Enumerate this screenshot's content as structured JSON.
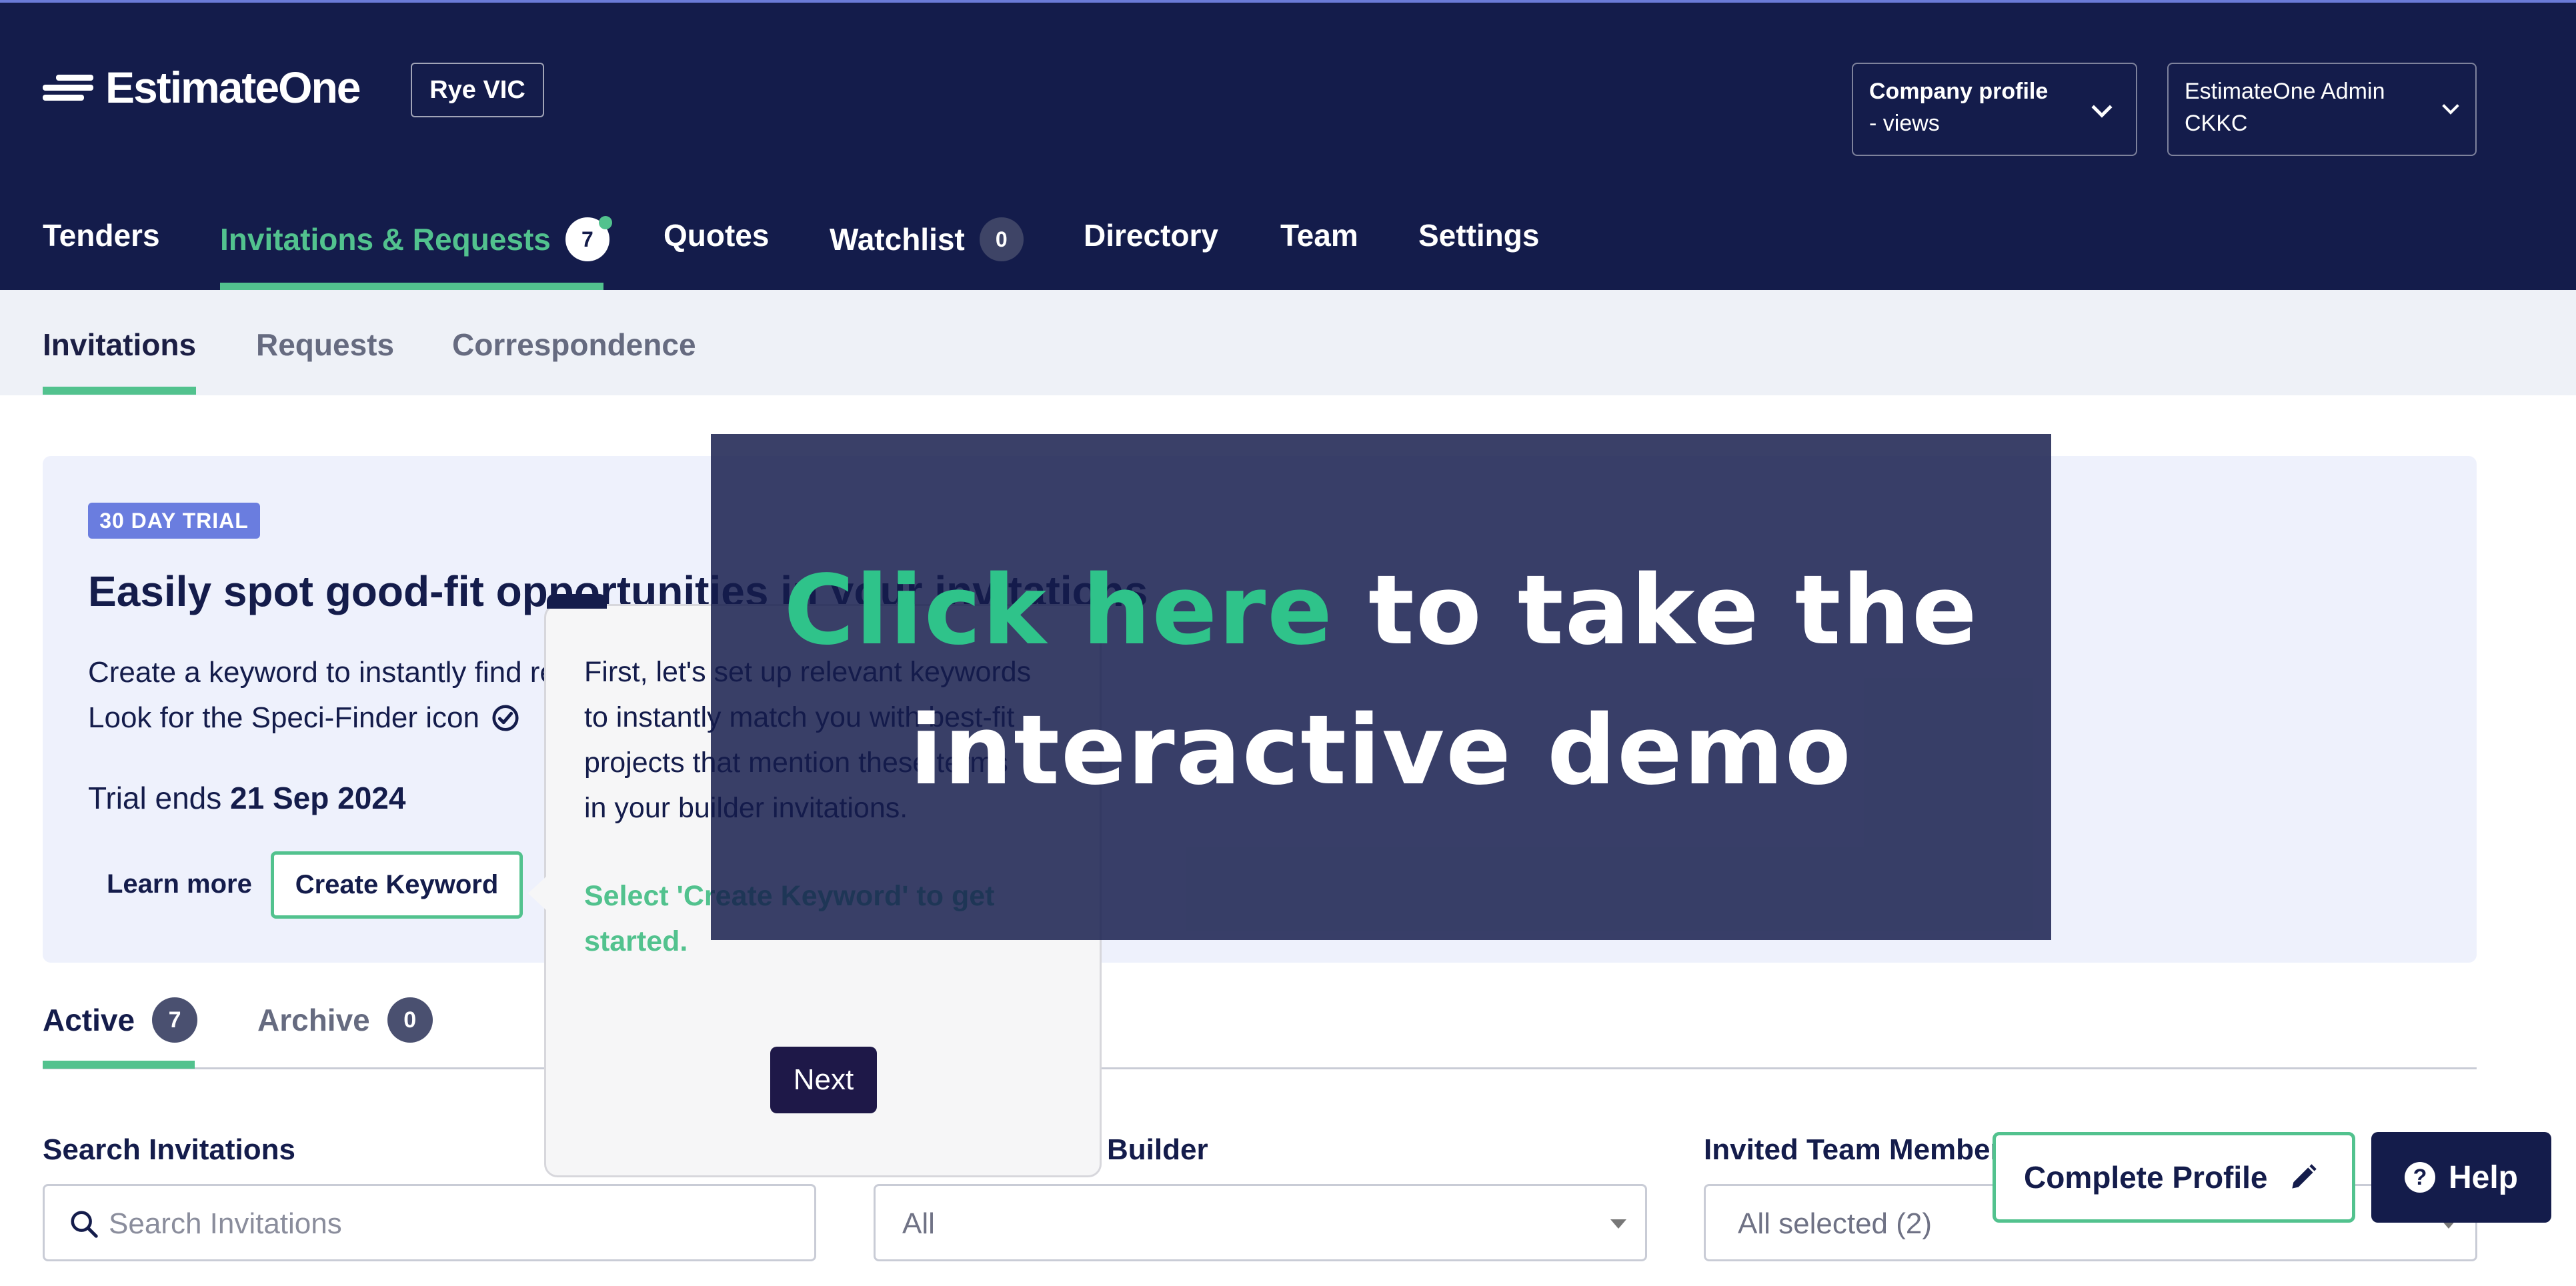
{
  "header": {
    "logo_text": "EstimateOne",
    "location": "Rye VIC",
    "company_profile": {
      "line1": "Company profile",
      "line2": "- views"
    },
    "user_menu": {
      "line1": "EstimateOne Admin",
      "line2": "CKKC"
    }
  },
  "nav": {
    "items": [
      {
        "label": "Tenders"
      },
      {
        "label": "Invitations & Requests",
        "badge": "7"
      },
      {
        "label": "Quotes"
      },
      {
        "label": "Watchlist",
        "badge": "0"
      },
      {
        "label": "Directory"
      },
      {
        "label": "Team"
      },
      {
        "label": "Settings"
      }
    ]
  },
  "subnav": {
    "items": [
      {
        "label": "Invitations"
      },
      {
        "label": "Requests"
      },
      {
        "label": "Correspondence"
      }
    ]
  },
  "banner": {
    "badge": "30 DAY TRIAL",
    "title": "Easily spot good-fit opportunities in your invitations",
    "line1": "Create a keyword to instantly find relevant mentions in tender documents.",
    "line2": "Look for the Speci-Finder icon",
    "trial_prefix": "Trial ends ",
    "trial_date": "21 Sep 2024",
    "learn_more": "Learn more",
    "create_keyword": "Create Keyword"
  },
  "tabs": {
    "active": {
      "label": "Active",
      "count": "7"
    },
    "archive": {
      "label": "Archive",
      "count": "0"
    }
  },
  "filters": {
    "search": {
      "label": "Search Invitations",
      "placeholder": "Search Invitations"
    },
    "builder": {
      "label": "Builder",
      "value": "All"
    },
    "team": {
      "label": "Invited Team Member",
      "value": "All selected (2)"
    }
  },
  "tooltip": {
    "line1": "First, let's set up relevant keywords",
    "line2": "to instantly match you with best-fit",
    "line3": "projects that mention these terms",
    "line4": "in your builder invitations.",
    "cta_line1": "Select 'Create Keyword' to get",
    "cta_line2": "started.",
    "next": "Next"
  },
  "demo_overlay": {
    "highlight": "Click here",
    "rest_line1": " to take the",
    "line2": "interactive demo"
  },
  "floating": {
    "complete_profile": "Complete Profile",
    "help": "Help"
  },
  "colors": {
    "header_bg": "#141c4b",
    "accent_green": "#52c28e",
    "trial_badge": "#6a7ddf"
  }
}
